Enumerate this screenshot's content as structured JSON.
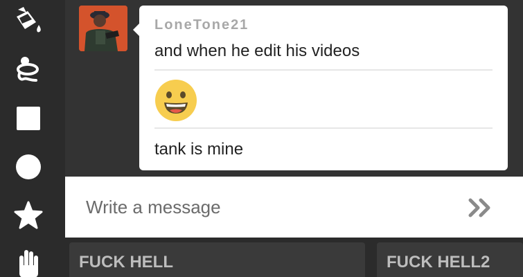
{
  "toolbar": {
    "tools": [
      {
        "icon": "paint-bucket-icon"
      },
      {
        "icon": "lasso-icon"
      },
      {
        "icon": "square-icon"
      },
      {
        "icon": "circle-icon"
      },
      {
        "icon": "star-icon"
      },
      {
        "icon": "hand-icon"
      }
    ]
  },
  "chat": {
    "username": "LoneTone21",
    "messages": [
      "and when he edit his videos",
      "tank is mine"
    ],
    "emoji": "grinning-face-emoji"
  },
  "composer": {
    "placeholder": "Write a message",
    "send_icon": "double-chevron-right-icon"
  },
  "boards": [
    {
      "title": "FUCK HELL"
    },
    {
      "title": "FUCK HELL2"
    }
  ],
  "colors": {
    "background": "#2b2b2b",
    "chat_background": "#333333",
    "bubble": "#ffffff",
    "avatar_bg": "#d4532c",
    "emoji_face": "#f7cd4f"
  }
}
